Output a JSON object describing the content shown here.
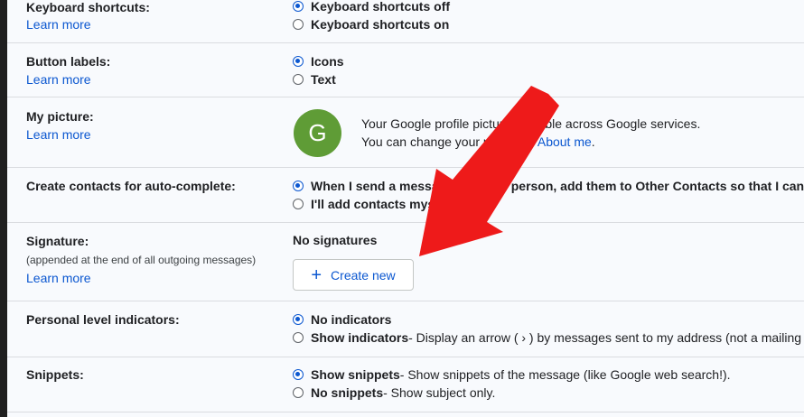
{
  "rows": {
    "keyboard": {
      "label": "Keyboard shortcuts:",
      "learn_more": "Learn more",
      "options": [
        {
          "label": "Keyboard shortcuts off",
          "selected": true
        },
        {
          "label": "Keyboard shortcuts on",
          "selected": false
        }
      ]
    },
    "button_labels": {
      "label": "Button labels:",
      "learn_more": "Learn more",
      "options": [
        {
          "label": "Icons",
          "selected": true
        },
        {
          "label": "Text",
          "selected": false
        }
      ]
    },
    "picture": {
      "label": "My picture:",
      "learn_more": "Learn more",
      "avatar_letter": "G",
      "line1": "Your Google profile picture is visible across Google services.",
      "line2_prefix": "You can change your picture in ",
      "line2_link": "About me",
      "line2_suffix": "."
    },
    "contacts": {
      "label": "Create contacts for auto-complete:",
      "options": [
        {
          "label": "When I send a message to a new person, add them to Other Contacts so that I can",
          "selected": true
        },
        {
          "label": "I'll add contacts myself",
          "selected": false
        }
      ]
    },
    "signature": {
      "label": "Signature:",
      "sublabel": "(appended at the end of all outgoing messages)",
      "learn_more": "Learn more",
      "no_signatures": "No signatures",
      "create_new": "Create new",
      "create_icon": "plus-icon"
    },
    "personal": {
      "label": "Personal level indicators:",
      "options": [
        {
          "label": "No indicators",
          "desc": "",
          "selected": true
        },
        {
          "label": "Show indicators",
          "desc": " - Display an arrow ( › ) by messages sent to my address (not a mailing list)",
          "selected": false
        }
      ]
    },
    "snippets": {
      "label": "Snippets:",
      "options": [
        {
          "label": "Show snippets",
          "desc": " - Show snippets of the message (like Google web search!).",
          "selected": true
        },
        {
          "label": "No snippets",
          "desc": " - Show subject only.",
          "selected": false
        }
      ]
    }
  },
  "colors": {
    "accent": "#0b57d0",
    "annotation_arrow": "#ee1a1a",
    "avatar_bg": "#5f9c36"
  }
}
